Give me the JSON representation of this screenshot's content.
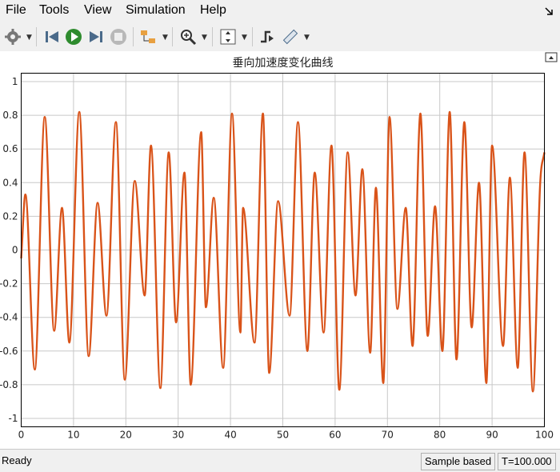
{
  "menu": {
    "file": "File",
    "tools": "Tools",
    "view": "View",
    "simulation": "Simulation",
    "help": "Help"
  },
  "status": {
    "ready": "Ready",
    "mode": "Sample based",
    "time": "T=100.000"
  },
  "colors": {
    "series": "#d95319",
    "grid": "#c8c8c8",
    "axis": "#000000"
  },
  "chart_data": {
    "type": "line",
    "title": "垂向加速度变化曲线",
    "xlim": [
      0,
      100
    ],
    "ylim": [
      -1.05,
      1.05
    ],
    "xticks": [
      0,
      10,
      20,
      30,
      40,
      50,
      60,
      70,
      80,
      90,
      100
    ],
    "yticks": [
      -1,
      -0.8,
      -0.6,
      -0.4,
      -0.2,
      0,
      0.2,
      0.4,
      0.6,
      0.8,
      1
    ],
    "ytick_labels": [
      "-1",
      "-0.8",
      "-0.6",
      "-0.4",
      "-0.2",
      "0",
      "0.2",
      "0.4",
      "0.6",
      "0.8",
      "1"
    ],
    "grid": true,
    "series": [
      {
        "color": "#d95319",
        "x": [
          0,
          0.8,
          2.6,
          4.5,
          6.3,
          7.8,
          9.2,
          11.1,
          12.9,
          14.6,
          16.3,
          18.1,
          19.8,
          21.7,
          23.6,
          24.8,
          26.6,
          28.2,
          29.6,
          31.2,
          32.4,
          34.4,
          35.3,
          36.8,
          38.6,
          40.3,
          41.9,
          42.4,
          44.6,
          46.2,
          47.4,
          49.1,
          51.3,
          52.9,
          54.7,
          56.1,
          57.8,
          59.3,
          60.8,
          62.4,
          63.9,
          65.2,
          66.7,
          67.8,
          69.2,
          70.4,
          71.9,
          73.5,
          74.8,
          76.3,
          77.7,
          79.1,
          80.5,
          81.9,
          83.2,
          84.7,
          86.1,
          87.5,
          88.9,
          90.0,
          92.1,
          93.4,
          94.9,
          96.2,
          97.8,
          99.2,
          100
        ],
        "y": [
          -0.05,
          0.33,
          -0.71,
          0.79,
          -0.48,
          0.25,
          -0.55,
          0.82,
          -0.63,
          0.28,
          -0.39,
          0.76,
          -0.77,
          0.41,
          -0.27,
          0.62,
          -0.82,
          0.58,
          -0.43,
          0.46,
          -0.8,
          0.7,
          -0.34,
          0.31,
          -0.7,
          0.81,
          -0.49,
          0.25,
          -0.55,
          0.81,
          -0.73,
          0.29,
          -0.39,
          0.76,
          -0.6,
          0.46,
          -0.49,
          0.62,
          -0.83,
          0.58,
          -0.27,
          0.48,
          -0.61,
          0.37,
          -0.79,
          0.79,
          -0.35,
          0.25,
          -0.57,
          0.81,
          -0.51,
          0.26,
          -0.6,
          0.82,
          -0.65,
          0.76,
          -0.46,
          0.4,
          -0.79,
          0.62,
          -0.57,
          0.43,
          -0.7,
          0.58,
          -0.84,
          0.4,
          0.58
        ]
      }
    ]
  }
}
